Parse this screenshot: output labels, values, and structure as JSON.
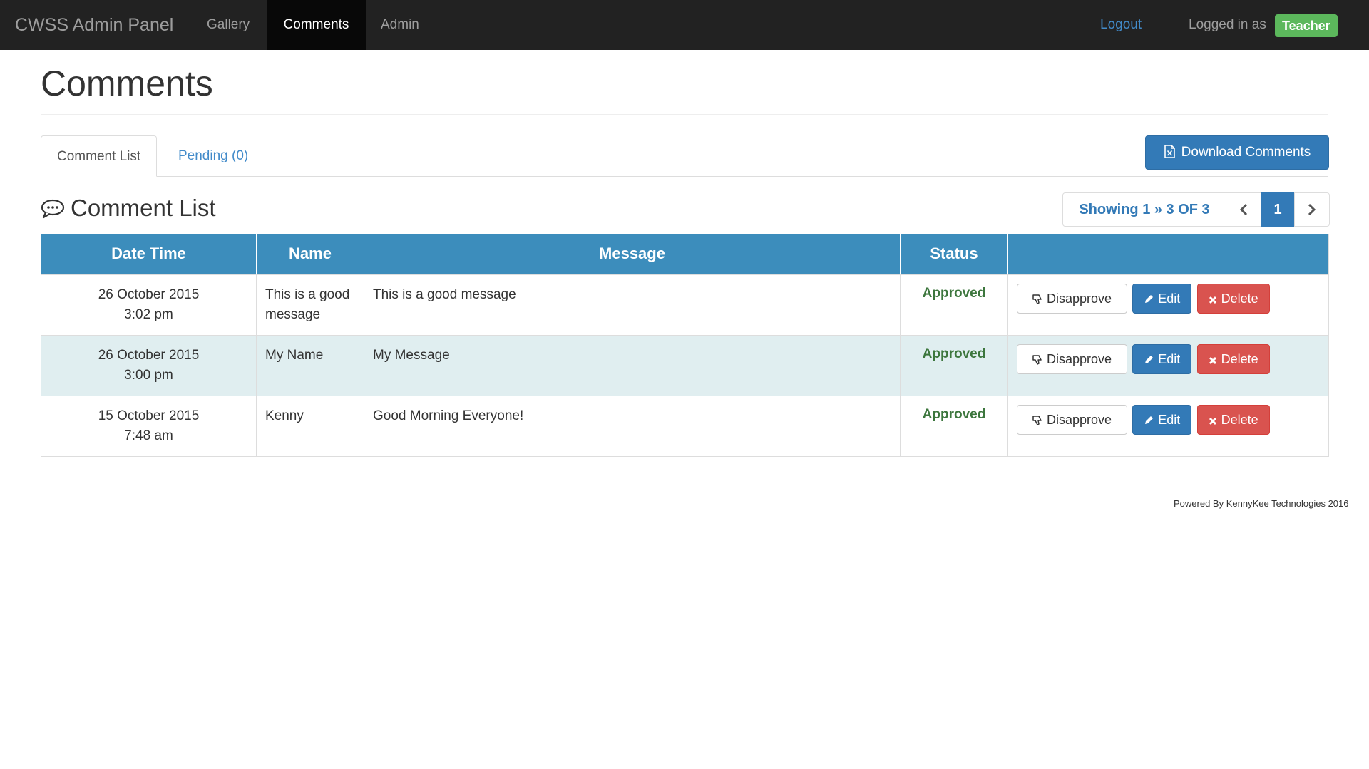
{
  "navbar": {
    "brand": "CWSS Admin Panel",
    "links": [
      {
        "label": "Gallery"
      },
      {
        "label": "Comments"
      },
      {
        "label": "Admin"
      }
    ],
    "logout_label": "Logout",
    "logged_in_label": "Logged in as",
    "role": "Teacher"
  },
  "page": {
    "title": "Comments"
  },
  "tabs": [
    {
      "label": "Comment List"
    },
    {
      "label": "Pending (0)"
    }
  ],
  "download_label": "Download Comments",
  "section": {
    "title": "Comment List",
    "icon": "comments-icon"
  },
  "pagination": {
    "info": "Showing 1 » 3 OF 3",
    "current_page": "1"
  },
  "table": {
    "headers": [
      "Date Time",
      "Name",
      "Message",
      "Status",
      ""
    ],
    "rows": [
      {
        "date": "26 October 2015",
        "time": "3:02 pm",
        "name": "This is a good message",
        "message": "This is a good message",
        "status": "Approved"
      },
      {
        "date": "26 October 2015",
        "time": "3:00 pm",
        "name": "My Name",
        "message": "My Message",
        "status": "Approved"
      },
      {
        "date": "15 October 2015",
        "time": "7:48 am",
        "name": "Kenny",
        "message": "Good Morning Everyone!",
        "status": "Approved"
      }
    ],
    "actions": {
      "disapprove": "Disapprove",
      "edit": "Edit",
      "delete": "Delete"
    }
  },
  "footer": "Powered By KennyKee Technologies 2016",
  "colors": {
    "navbar": "#222222",
    "accent": "#337ab7",
    "table_header": "#3c8dbc",
    "approved": "#3c763d",
    "danger": "#d9534f",
    "success_badge": "#5cb85c"
  }
}
